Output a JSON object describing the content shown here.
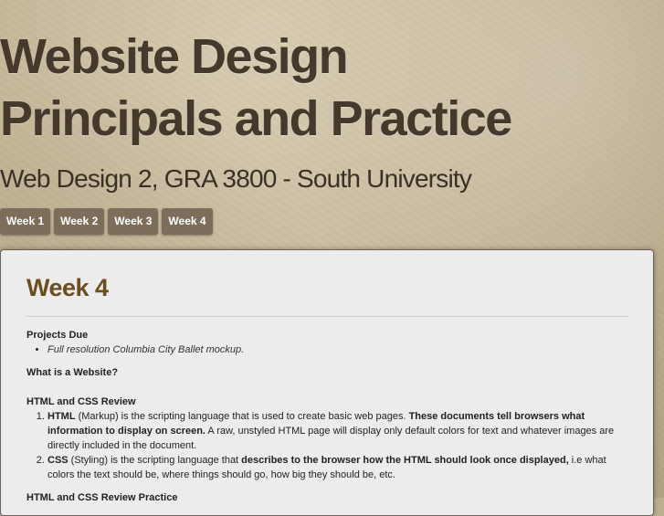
{
  "header": {
    "title_line1": "Website Design",
    "title_line2": "Principals and Practice",
    "subtitle": "Web Design 2, GRA 3800 - South University"
  },
  "nav": {
    "items": [
      {
        "label": "Week 1"
      },
      {
        "label": "Week 2"
      },
      {
        "label": "Week 3"
      },
      {
        "label": "Week 4"
      }
    ]
  },
  "main": {
    "heading": "Week 4",
    "projects_due_label": "Projects Due",
    "projects_due_item": "Full resolution Columbia City Ballet mockup.",
    "what_is_label": "What is a Website?",
    "review_label": "HTML and CSS Review",
    "review_items": [
      {
        "term": "HTML",
        "t1": " (Markup) is the scripting language that is used to create basic web pages. ",
        "bold": "These documents tell browsers what information to display on screen.",
        "t2": " A raw, unstyled HTML page will display only default colors for text and whatever images are directly included in the document."
      },
      {
        "term": "CSS",
        "t1": " (Styling) is the scripting language that ",
        "bold": "describes to the browser how the HTML should look once displayed,",
        "t2": " i.e what colors the text should be, where things should go, how big they should be, etc."
      }
    ],
    "next_label": "HTML and CSS Review Practice"
  }
}
